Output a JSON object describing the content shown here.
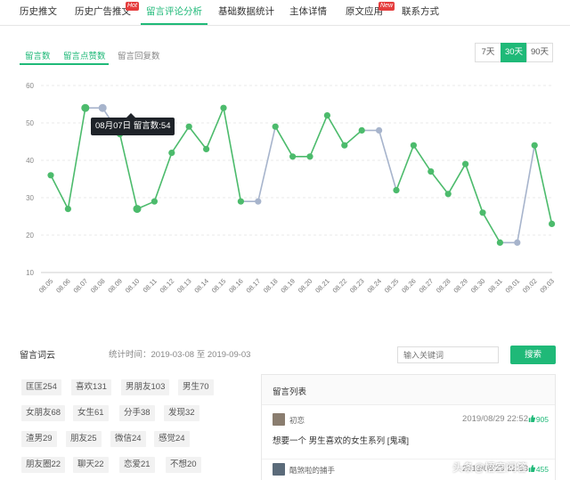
{
  "nav": {
    "tabs": [
      {
        "label": "历史推文"
      },
      {
        "label": "历史广告推文",
        "badge": "Hot"
      },
      {
        "label": "留言评论分析"
      },
      {
        "label": "基础数据统计"
      },
      {
        "label": "主体详情"
      },
      {
        "label": "原文应用",
        "badge": "New"
      },
      {
        "label": "联系方式"
      }
    ],
    "active_index": 2
  },
  "subtabs": [
    "留言数",
    "留言点赞数",
    "留言回复数"
  ],
  "range_buttons": [
    "7天",
    "30天",
    "90天"
  ],
  "range_selected": "30天",
  "tooltip": "08月07日 留言数:54",
  "chart_data": {
    "type": "line",
    "x": [
      "08.05",
      "08.06",
      "08.07",
      "08.08",
      "08.09",
      "08.10",
      "08.11",
      "08.12",
      "08.13",
      "08.14",
      "08.15",
      "08.16",
      "08.17",
      "08.18",
      "08.19",
      "08.20",
      "08.21",
      "08.22",
      "08.23",
      "08.24",
      "08.25",
      "08.26",
      "08.27",
      "08.28",
      "08.29",
      "08.30",
      "08.31",
      "09.01",
      "09.02",
      "09.03"
    ],
    "values": [
      36,
      27,
      54,
      54,
      47,
      27,
      29,
      42,
      49,
      43,
      54,
      29,
      29,
      49,
      41,
      41,
      52,
      44,
      48,
      48,
      32,
      44,
      37,
      31,
      39,
      26,
      18,
      18,
      44,
      23
    ],
    "highlight_gray": [
      "08.08",
      "08.17",
      "08.24",
      "09.01"
    ],
    "ylim": [
      10,
      60
    ],
    "yticks": [
      10,
      20,
      30,
      40,
      50,
      60
    ],
    "colors": {
      "line": "#4cbb6c",
      "gray": "#a7b4cc",
      "grid": "#e8e8e8"
    }
  },
  "cloud": {
    "title": "留言词云",
    "stat_time": "统计时间：2019-03-08 至 2019-09-03",
    "tags": [
      [
        "匡匡254",
        "喜欢131",
        "男朋友103",
        "男生70"
      ],
      [
        "女朋友68",
        "女生61",
        "分手38",
        "发现32"
      ],
      [
        "渣男29",
        "朋友25",
        "微信24",
        "感觉24"
      ],
      [
        "朋友圈22",
        "聊天22",
        "恋爱21",
        "不想20"
      ]
    ]
  },
  "search": {
    "placeholder": "输入关键词",
    "button": "搜索"
  },
  "comments": {
    "title": "留言列表",
    "items": [
      {
        "name": "初恋",
        "time": "2019/08/29 22:52",
        "likes": "905",
        "text": "想要一个 男生喜欢的女生系列 [鬼魂]"
      },
      {
        "name": "酷煞啦的捕手",
        "time": "2019/08/29 22:53",
        "likes": "455",
        "text": ""
      }
    ]
  },
  "watermark": "头条@悟空问答"
}
